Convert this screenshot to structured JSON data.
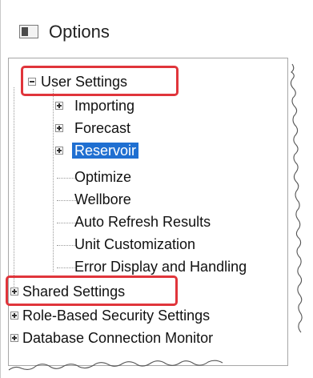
{
  "window": {
    "title": "Options",
    "icon": "window-icon"
  },
  "tree": {
    "user_settings": "User Settings",
    "importing": "Importing",
    "forecast": "Forecast",
    "reservoir": "Reservoir",
    "optimize": "Optimize",
    "wellbore": "Wellbore",
    "auto_refresh": "Auto Refresh Results",
    "unit_customization": "Unit Customization",
    "error_display": "Error Display and Handling",
    "shared_settings": "Shared Settings",
    "role_security": "Role-Based Security Settings",
    "db_monitor": "Database Connection Monitor"
  },
  "highlight_color": "#e0353b",
  "selection_color": "#1f6fd1"
}
